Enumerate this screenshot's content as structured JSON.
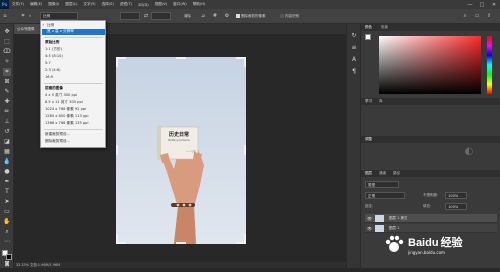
{
  "menubar": {
    "logo": "Ps",
    "items": [
      "文件(F)",
      "编辑(E)",
      "图像(I)",
      "图层(L)",
      "文字(Y)",
      "选择(S)",
      "滤镜(T)",
      "3D(D)",
      "视图(V)",
      "窗口(W)",
      "帮助(H)"
    ],
    "minimize": "—",
    "maximize": "□",
    "close": "✕"
  },
  "options": {
    "ratio_value": "比例",
    "clear_label": "清除",
    "straighten_label": "拉直",
    "delete_cropped_label": "删除裁剪的像素",
    "content_aware_label": "内容识别"
  },
  "tab": {
    "title": "公众号图像"
  },
  "dropdown": {
    "items": [
      {
        "label": "比例",
        "kind": "item",
        "checked": true
      },
      {
        "label": "宽 x 高 x 分辨率",
        "kind": "selected"
      },
      {
        "label": "原始比例",
        "kind": "head"
      },
      {
        "label": "1:1 (方形)",
        "kind": "item"
      },
      {
        "label": "4:5 (8:10)",
        "kind": "item"
      },
      {
        "label": "5:7",
        "kind": "item"
      },
      {
        "label": "2:3 (4:6)",
        "kind": "item"
      },
      {
        "label": "16:9",
        "kind": "item"
      },
      {
        "label": "前面的图像",
        "kind": "head"
      },
      {
        "label": "4 x 5 英寸 300 ppi",
        "kind": "item"
      },
      {
        "label": "8.5 x 11 英寸 300 ppi",
        "kind": "item"
      },
      {
        "label": "1024 x 768 像素 92 ppi",
        "kind": "item"
      },
      {
        "label": "1280 x 800 像素 113 ppi",
        "kind": "item"
      },
      {
        "label": "1366 x 768 像素 135 ppi",
        "kind": "item"
      },
      {
        "label": "新建裁剪预设...",
        "kind": "item"
      },
      {
        "label": "删除裁剪预设...",
        "kind": "item"
      }
    ]
  },
  "photo": {
    "book_title": "历史日常",
    "book_subtitle": "Nothing remains",
    "book_author": "—— 小记"
  },
  "panels": {
    "color_tab": "颜色",
    "swatches_tab": "色板",
    "learn_tab": "学习",
    "libraries_tab": "库",
    "adjust_tab": "调整",
    "layers_tab": "图层",
    "channels_tab": "通道",
    "paths_tab": "路径",
    "kind_label": "类型",
    "blend_mode": "正常",
    "opacity_label": "不透明度:",
    "opacity_value": "100%",
    "lock_label": "锁定:",
    "fill_label": "填充:",
    "fill_value": "100%",
    "layer1_name": "图层 1 拷贝",
    "layer2_name": "图层 1",
    "accent_color": "#ff3b3b"
  },
  "status": {
    "text": "33.33%   文档:1.96M/1.96M"
  },
  "watermark": {
    "brand": "Baidu",
    "suffix": "经验",
    "url": "jingyan.baidu.com"
  }
}
